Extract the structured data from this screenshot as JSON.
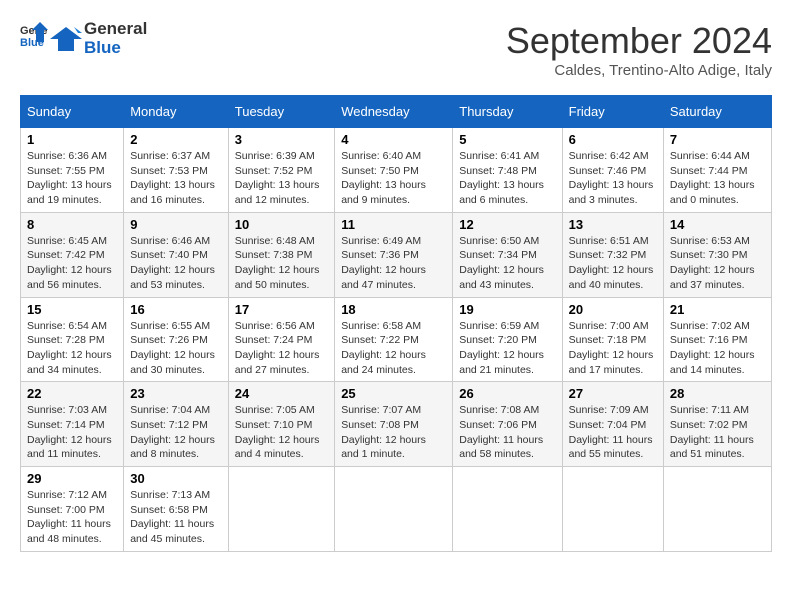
{
  "header": {
    "logo_general": "General",
    "logo_blue": "Blue",
    "month_title": "September 2024",
    "subtitle": "Caldes, Trentino-Alto Adige, Italy"
  },
  "weekdays": [
    "Sunday",
    "Monday",
    "Tuesday",
    "Wednesday",
    "Thursday",
    "Friday",
    "Saturday"
  ],
  "weeks": [
    [
      {
        "day": "1",
        "sunrise": "Sunrise: 6:36 AM",
        "sunset": "Sunset: 7:55 PM",
        "daylight": "Daylight: 13 hours and 19 minutes."
      },
      {
        "day": "2",
        "sunrise": "Sunrise: 6:37 AM",
        "sunset": "Sunset: 7:53 PM",
        "daylight": "Daylight: 13 hours and 16 minutes."
      },
      {
        "day": "3",
        "sunrise": "Sunrise: 6:39 AM",
        "sunset": "Sunset: 7:52 PM",
        "daylight": "Daylight: 13 hours and 12 minutes."
      },
      {
        "day": "4",
        "sunrise": "Sunrise: 6:40 AM",
        "sunset": "Sunset: 7:50 PM",
        "daylight": "Daylight: 13 hours and 9 minutes."
      },
      {
        "day": "5",
        "sunrise": "Sunrise: 6:41 AM",
        "sunset": "Sunset: 7:48 PM",
        "daylight": "Daylight: 13 hours and 6 minutes."
      },
      {
        "day": "6",
        "sunrise": "Sunrise: 6:42 AM",
        "sunset": "Sunset: 7:46 PM",
        "daylight": "Daylight: 13 hours and 3 minutes."
      },
      {
        "day": "7",
        "sunrise": "Sunrise: 6:44 AM",
        "sunset": "Sunset: 7:44 PM",
        "daylight": "Daylight: 13 hours and 0 minutes."
      }
    ],
    [
      {
        "day": "8",
        "sunrise": "Sunrise: 6:45 AM",
        "sunset": "Sunset: 7:42 PM",
        "daylight": "Daylight: 12 hours and 56 minutes."
      },
      {
        "day": "9",
        "sunrise": "Sunrise: 6:46 AM",
        "sunset": "Sunset: 7:40 PM",
        "daylight": "Daylight: 12 hours and 53 minutes."
      },
      {
        "day": "10",
        "sunrise": "Sunrise: 6:48 AM",
        "sunset": "Sunset: 7:38 PM",
        "daylight": "Daylight: 12 hours and 50 minutes."
      },
      {
        "day": "11",
        "sunrise": "Sunrise: 6:49 AM",
        "sunset": "Sunset: 7:36 PM",
        "daylight": "Daylight: 12 hours and 47 minutes."
      },
      {
        "day": "12",
        "sunrise": "Sunrise: 6:50 AM",
        "sunset": "Sunset: 7:34 PM",
        "daylight": "Daylight: 12 hours and 43 minutes."
      },
      {
        "day": "13",
        "sunrise": "Sunrise: 6:51 AM",
        "sunset": "Sunset: 7:32 PM",
        "daylight": "Daylight: 12 hours and 40 minutes."
      },
      {
        "day": "14",
        "sunrise": "Sunrise: 6:53 AM",
        "sunset": "Sunset: 7:30 PM",
        "daylight": "Daylight: 12 hours and 37 minutes."
      }
    ],
    [
      {
        "day": "15",
        "sunrise": "Sunrise: 6:54 AM",
        "sunset": "Sunset: 7:28 PM",
        "daylight": "Daylight: 12 hours and 34 minutes."
      },
      {
        "day": "16",
        "sunrise": "Sunrise: 6:55 AM",
        "sunset": "Sunset: 7:26 PM",
        "daylight": "Daylight: 12 hours and 30 minutes."
      },
      {
        "day": "17",
        "sunrise": "Sunrise: 6:56 AM",
        "sunset": "Sunset: 7:24 PM",
        "daylight": "Daylight: 12 hours and 27 minutes."
      },
      {
        "day": "18",
        "sunrise": "Sunrise: 6:58 AM",
        "sunset": "Sunset: 7:22 PM",
        "daylight": "Daylight: 12 hours and 24 minutes."
      },
      {
        "day": "19",
        "sunrise": "Sunrise: 6:59 AM",
        "sunset": "Sunset: 7:20 PM",
        "daylight": "Daylight: 12 hours and 21 minutes."
      },
      {
        "day": "20",
        "sunrise": "Sunrise: 7:00 AM",
        "sunset": "Sunset: 7:18 PM",
        "daylight": "Daylight: 12 hours and 17 minutes."
      },
      {
        "day": "21",
        "sunrise": "Sunrise: 7:02 AM",
        "sunset": "Sunset: 7:16 PM",
        "daylight": "Daylight: 12 hours and 14 minutes."
      }
    ],
    [
      {
        "day": "22",
        "sunrise": "Sunrise: 7:03 AM",
        "sunset": "Sunset: 7:14 PM",
        "daylight": "Daylight: 12 hours and 11 minutes."
      },
      {
        "day": "23",
        "sunrise": "Sunrise: 7:04 AM",
        "sunset": "Sunset: 7:12 PM",
        "daylight": "Daylight: 12 hours and 8 minutes."
      },
      {
        "day": "24",
        "sunrise": "Sunrise: 7:05 AM",
        "sunset": "Sunset: 7:10 PM",
        "daylight": "Daylight: 12 hours and 4 minutes."
      },
      {
        "day": "25",
        "sunrise": "Sunrise: 7:07 AM",
        "sunset": "Sunset: 7:08 PM",
        "daylight": "Daylight: 12 hours and 1 minute."
      },
      {
        "day": "26",
        "sunrise": "Sunrise: 7:08 AM",
        "sunset": "Sunset: 7:06 PM",
        "daylight": "Daylight: 11 hours and 58 minutes."
      },
      {
        "day": "27",
        "sunrise": "Sunrise: 7:09 AM",
        "sunset": "Sunset: 7:04 PM",
        "daylight": "Daylight: 11 hours and 55 minutes."
      },
      {
        "day": "28",
        "sunrise": "Sunrise: 7:11 AM",
        "sunset": "Sunset: 7:02 PM",
        "daylight": "Daylight: 11 hours and 51 minutes."
      }
    ],
    [
      {
        "day": "29",
        "sunrise": "Sunrise: 7:12 AM",
        "sunset": "Sunset: 7:00 PM",
        "daylight": "Daylight: 11 hours and 48 minutes."
      },
      {
        "day": "30",
        "sunrise": "Sunrise: 7:13 AM",
        "sunset": "Sunset: 6:58 PM",
        "daylight": "Daylight: 11 hours and 45 minutes."
      },
      null,
      null,
      null,
      null,
      null
    ]
  ]
}
